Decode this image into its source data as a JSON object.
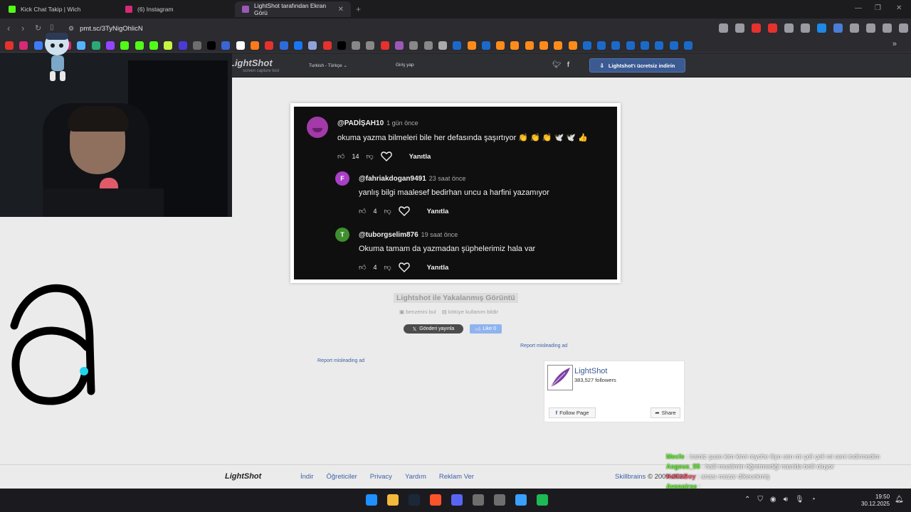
{
  "browser": {
    "tabs": [
      {
        "label": "Kick Chat Takip | Wich",
        "favicon_color": "#53fc18",
        "active": false
      },
      {
        "label": "(6) Instagram",
        "favicon_color": "#d62976",
        "active": false
      },
      {
        "label": "LightShot tarafından Ekran Görü",
        "favicon_color": "#9b59b6",
        "active": true
      }
    ],
    "url": "pmt.sc/3TyNigOhlicN",
    "bookmark_colors": [
      "#e5322d",
      "#d62976",
      "#3e7bf7",
      "#2f6bd8",
      "#d62976",
      "#56b3ff",
      "#2aa876",
      "#9146ff",
      "#53fc18",
      "#53fc18",
      "#53fc18",
      "#c6f542",
      "#4b3ad6",
      "#6e6e6e",
      "#000000",
      "#3a66d4",
      "#ffffff",
      "#ff7a1a",
      "#e5322d",
      "#2f6bd8",
      "#1877f2",
      "#8fa3d9",
      "#e5322d",
      "#000000",
      "#888888",
      "#888888",
      "#e5322d",
      "#9b59b6",
      "#888888",
      "#888888",
      "#aaaaaa",
      "#1b6ac9",
      "#ff8c1a",
      "#1b6ac9",
      "#ff8c1a",
      "#ff8c1a",
      "#ff8c1a",
      "#ff8c1a",
      "#ff8c1a",
      "#ff8c1a",
      "#1b6ac9",
      "#1b6ac9",
      "#1b6ac9",
      "#1b6ac9",
      "#1b6ac9",
      "#1b6ac9",
      "#1b6ac9",
      "#1b6ac9"
    ],
    "toolbar_icon_colors": [
      "#9a9aa2",
      "#9a9aa2",
      "#e5322d",
      "#e5322d",
      "#9a9aa2",
      "#9a9aa2",
      "#1e88e5",
      "#4a7dd6",
      "#9a9aa2",
      "#9a9aa2",
      "#9a9aa2",
      "#9a9aa2",
      "#9a9aa2"
    ],
    "more_bookmarks": "»"
  },
  "lightshot": {
    "logo": "LightShot",
    "tagline": "screen capture tool",
    "language": "Turkish - Türkçe",
    "login": "Giriş yap",
    "download_button": "Lightshot'ı ücretsiz indirin",
    "caption": "Lightshot ile Yakalanmış Görüntü",
    "find_similar": "benzerini bul",
    "report_abuse": "kötüye kullanım bildir",
    "share_x": "Gönderi yayınla",
    "fb_like": "Like 0",
    "report_ad_1": "Report misleading ad",
    "report_ad_2": "Report misleading ad",
    "fb_page": {
      "name": "LightShot",
      "followers": "383,527 followers",
      "follow": "Follow Page",
      "share": "Share"
    },
    "footer": {
      "logo": "LightShot",
      "links": [
        "İndir",
        "Öğreticiler",
        "Privacy",
        "Yardım",
        "Reklam Ver"
      ],
      "company": "Skillbrains",
      "copyright": "© 2009-2022"
    }
  },
  "screenshot_comments": [
    {
      "user": "@PADİŞAH10",
      "time": "1 gün önce",
      "text": "okuma yazma bilmeleri bile her defasında şaşırtıyor 👏 👏 👏 🕊️ 🕊️ 👍",
      "likes": "14",
      "reply": "Yanıtla",
      "avatar_color": "#a23aa8",
      "avatar_letter": ""
    },
    {
      "user": "@fahriakdogan9491",
      "time": "23 saat önce",
      "text": "yanlış bilgi maalesef bedirhan uncu a harfini yazamıyor",
      "likes": "4",
      "reply": "Yanıtla",
      "avatar_color": "#a93fc7",
      "avatar_letter": "F"
    },
    {
      "user": "@tuborgselim876",
      "time": "19 saat önce",
      "text": "Okuma tamam da yazmadan şüphelerimiz hala var",
      "likes": "4",
      "reply": "Yanıtla",
      "avatar_color": "#3f8f2f",
      "avatar_letter": "T"
    }
  ],
  "stream_chat": [
    {
      "user": "Mecfe",
      "user_color": "#53fc18",
      "text": ": iramiz şuan kim kimi reyche iliyo sen mi çeli çeli mi seni indirmedim"
    },
    {
      "user": "Asgeus_55",
      "user_color": "#53fc18",
      "text": ": halil mualimin öğretmediği nasılda belli oluyor"
    },
    {
      "user": "HaliloBoy",
      "user_color": "#ff4d6a",
      "text": ": anası mezar dikecekmiş"
    },
    {
      "user": "Avenoirse",
      "user_color": "#53fc18",
      "text": ":"
    }
  ],
  "taskbar": {
    "app_colors": [
      "#1e90ff",
      "#f2b93b",
      "#1b2838",
      "#fb542b",
      "#5865f2",
      "#6e6e6e",
      "#6e6e6e",
      "#3aa0ff",
      "#1db954"
    ],
    "time": "19:50",
    "date": "30.12.2025"
  }
}
